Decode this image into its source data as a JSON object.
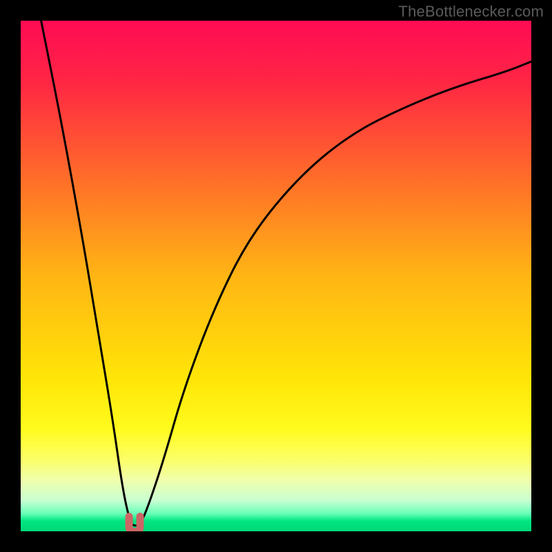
{
  "watermark": {
    "text": "TheBottlenecker.com"
  },
  "colors": {
    "page_bg": "#000000",
    "watermark": "#5b5b5b",
    "curve": "#000000",
    "marker": "#cc6666",
    "gradient_stops": [
      {
        "offset": 0.0,
        "color": "#ff0b54"
      },
      {
        "offset": 0.12,
        "color": "#ff2644"
      },
      {
        "offset": 0.3,
        "color": "#ff6a2a"
      },
      {
        "offset": 0.5,
        "color": "#ffb514"
      },
      {
        "offset": 0.7,
        "color": "#ffe507"
      },
      {
        "offset": 0.8,
        "color": "#fffb1e"
      },
      {
        "offset": 0.86,
        "color": "#fcff68"
      },
      {
        "offset": 0.9,
        "color": "#f0ffad"
      },
      {
        "offset": 0.94,
        "color": "#c8ffd2"
      },
      {
        "offset": 0.965,
        "color": "#6bffb8"
      },
      {
        "offset": 0.98,
        "color": "#00e680"
      },
      {
        "offset": 1.0,
        "color": "#00d877"
      }
    ]
  },
  "chart_data": {
    "type": "line",
    "title": "",
    "xlabel": "",
    "ylabel": "",
    "xlim": [
      0,
      1
    ],
    "ylim": [
      0,
      1
    ],
    "note": "Axes are unlabeled; x and y are normalized 0–1. Curve is a V-shaped bottleneck profile with minimum near x≈0.22.",
    "series": [
      {
        "name": "bottleneck-curve",
        "x": [
          0.04,
          0.08,
          0.12,
          0.15,
          0.18,
          0.2,
          0.215,
          0.225,
          0.235,
          0.25,
          0.28,
          0.32,
          0.38,
          0.45,
          0.55,
          0.65,
          0.75,
          0.85,
          0.95,
          1.0
        ],
        "y": [
          1.0,
          0.8,
          0.58,
          0.4,
          0.22,
          0.08,
          0.015,
          0.01,
          0.015,
          0.05,
          0.14,
          0.28,
          0.44,
          0.58,
          0.7,
          0.78,
          0.83,
          0.87,
          0.9,
          0.92
        ]
      }
    ],
    "annotations": [
      {
        "name": "min-marker",
        "x": 0.223,
        "y": 0.01,
        "shape": "u",
        "color": "#cc6666"
      }
    ]
  }
}
